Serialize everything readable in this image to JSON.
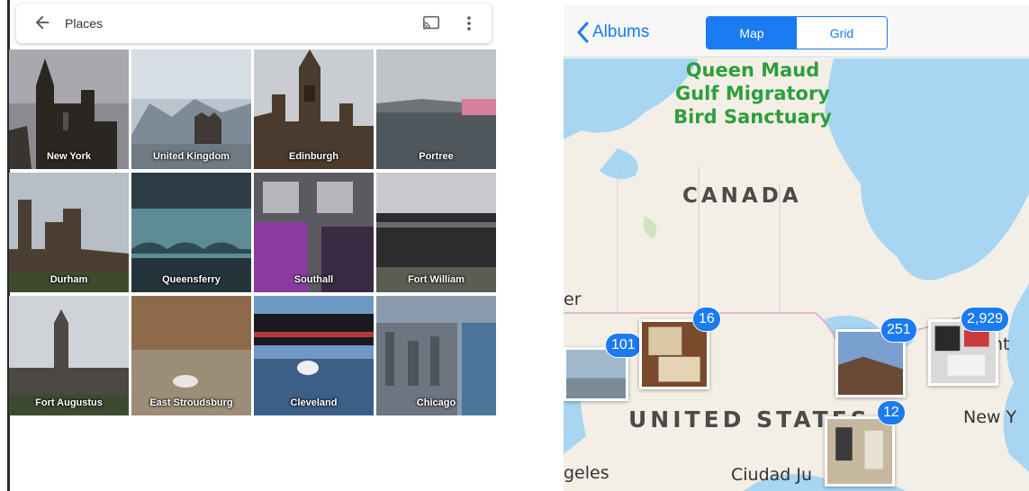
{
  "left": {
    "header": {
      "title": "Places",
      "icons": [
        "back-arrow-icon",
        "cast-icon",
        "more-vert-icon"
      ]
    },
    "places": [
      {
        "label": "New York"
      },
      {
        "label": "United Kingdom"
      },
      {
        "label": "Edinburgh"
      },
      {
        "label": "Portree"
      },
      {
        "label": "Durham"
      },
      {
        "label": "Queensferry"
      },
      {
        "label": "Southall"
      },
      {
        "label": "Fort William"
      },
      {
        "label": "Fort Augustus"
      },
      {
        "label": "East Stroudsburg"
      },
      {
        "label": "Cleveland"
      },
      {
        "label": "Chicago"
      }
    ]
  },
  "right": {
    "nav": {
      "back_label": "Albums",
      "segments": [
        {
          "label": "Map",
          "selected": true
        },
        {
          "label": "Grid",
          "selected": false
        }
      ]
    },
    "map": {
      "sanctuary_lines": [
        "Queen Maud",
        "Gulf Migratory",
        "Bird Sanctuary"
      ],
      "country_canada": "CANADA",
      "country_us": "UNITED STATES",
      "city_fragments": {
        "er": "er",
        "geles": "geles",
        "ciudad": "Ciudad Ju",
        "nt": "nt",
        "new_y": "New Y"
      },
      "clusters": [
        {
          "count": "101"
        },
        {
          "count": "16"
        },
        {
          "count": "251"
        },
        {
          "count": "2,929"
        },
        {
          "count": "12"
        }
      ]
    },
    "colors": {
      "accent": "#1a7bf2",
      "water": "#a7d5f2",
      "land": "#f3efe6",
      "park_green": "#2e9e3c"
    }
  }
}
